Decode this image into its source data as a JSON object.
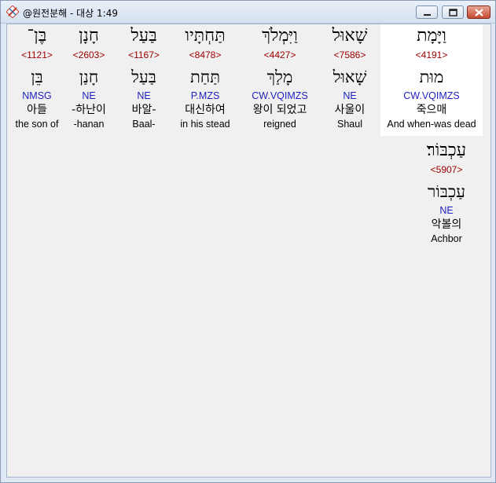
{
  "window": {
    "title": "@원전분해 - 대상 1:49"
  },
  "words": [
    {
      "surface": "וַיָּמָת",
      "strong": "<4191>",
      "lemma": "מוּת",
      "morph": "CW.VQIMZS",
      "korean": "죽으매",
      "english": "And when-was dead"
    },
    {
      "surface": "שָׁאוּל",
      "strong": "<7586>",
      "lemma": "שָׁאוּל",
      "morph": "NE",
      "korean": "사울이",
      "english": "Shaul"
    },
    {
      "surface": "וַיִּמְלֹךְ",
      "strong": "<4427>",
      "lemma": "מָלַךְ",
      "morph": "CW.VQIMZS",
      "korean": "왕이 되었고",
      "english": "reigned"
    },
    {
      "surface": "תַּחְתָּיו",
      "strong": "<8478>",
      "lemma": "תַּחַת",
      "morph": "P.MZS",
      "korean": "대신하여",
      "english": "in his stead"
    },
    {
      "surface": "בַּעַל",
      "strong": "<1167>",
      "lemma": "בַּעַל",
      "morph": "NE",
      "korean": "바알-",
      "english": "Baal-"
    },
    {
      "surface": "חָנָן",
      "strong": "<2603>",
      "lemma": "חָנַן",
      "morph": "NE",
      "korean": "-하난이",
      "english": "-hanan"
    },
    {
      "surface": "בֶּן־",
      "strong": "<1121>",
      "lemma": "בֵּן",
      "morph": "NMSG",
      "korean": "아들",
      "english": "the son of"
    },
    {
      "surface": "עַכְבּוֹר׃",
      "strong": "<5907>",
      "lemma": "עַכְבּוֹר",
      "morph": "NE",
      "korean": "악볼의",
      "english": "Achbor"
    }
  ]
}
